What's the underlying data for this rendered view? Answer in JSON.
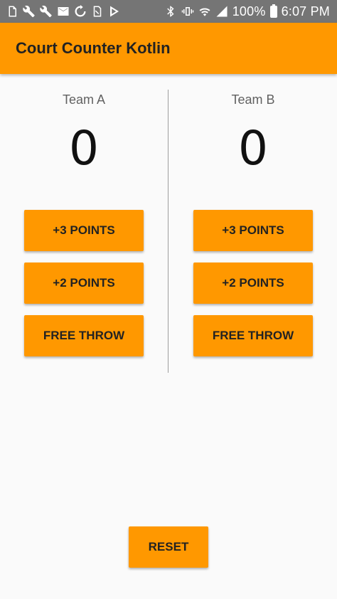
{
  "status_bar": {
    "left_icons": [
      "device-icon",
      "wrench-icon",
      "wrench-icon",
      "mail-icon",
      "sync-icon",
      "no-sim-icon",
      "play-store-icon"
    ],
    "right_icons": [
      "bluetooth-icon",
      "vibrate-icon",
      "wifi-icon",
      "signal-icon"
    ],
    "battery": "100%",
    "time": "6:07 PM"
  },
  "app_bar": {
    "title": "Court Counter Kotlin"
  },
  "team_a": {
    "name": "Team A",
    "score": "0",
    "buttons": {
      "three_points": "+3 POINTS",
      "two_points": "+2 POINTS",
      "free_throw": "FREE THROW"
    }
  },
  "team_b": {
    "name": "Team B",
    "score": "0",
    "buttons": {
      "three_points": "+3 POINTS",
      "two_points": "+2 POINTS",
      "free_throw": "FREE THROW"
    }
  },
  "reset": {
    "label": "RESET"
  },
  "colors": {
    "accent": "#ff9800",
    "status_bar": "#757575",
    "background": "#fafafa"
  }
}
